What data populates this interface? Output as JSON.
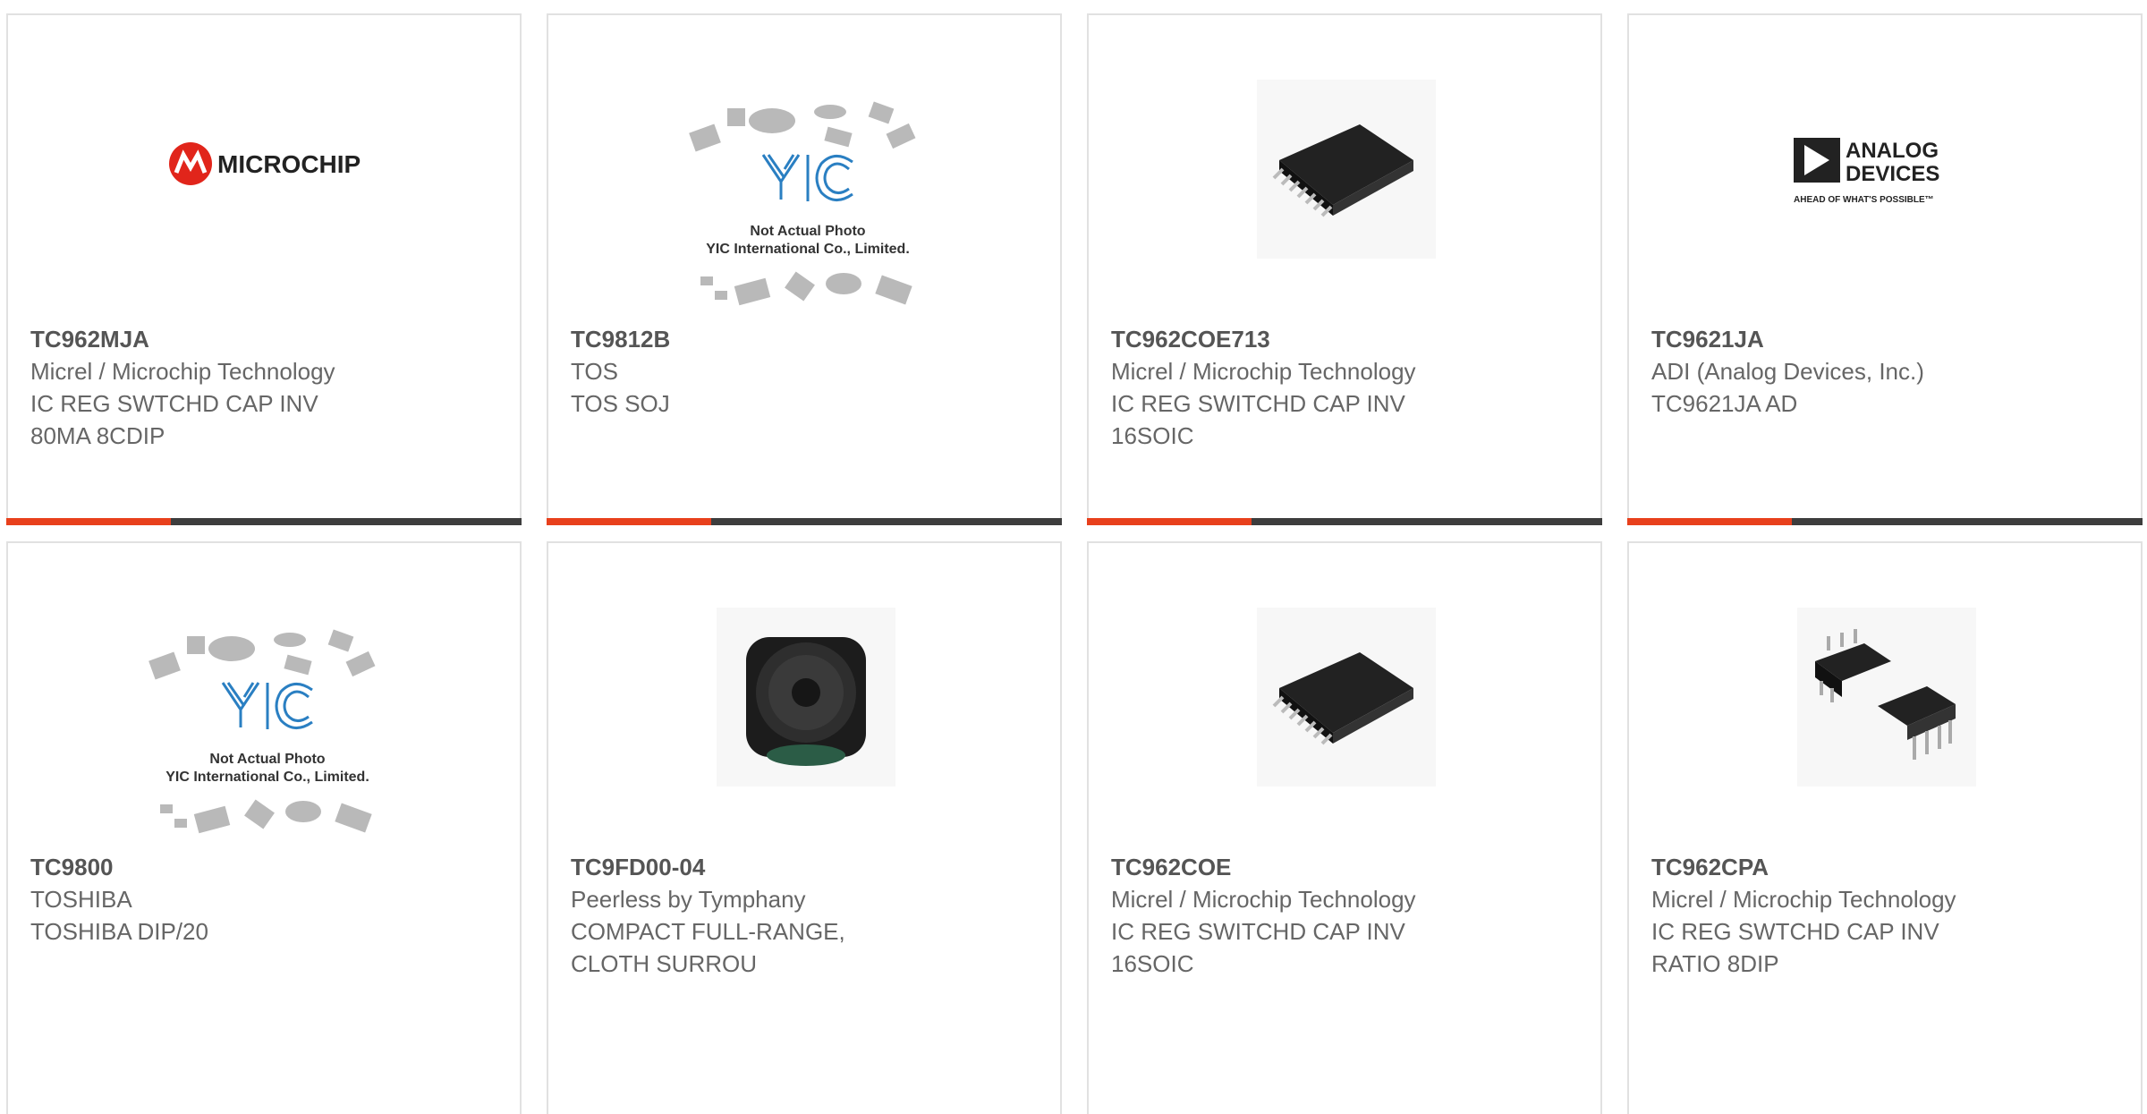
{
  "colors": {
    "accent": "#e8401c",
    "bar": "#3d3d3d",
    "border": "#e1e1e1"
  },
  "products": [
    {
      "part": "TC962MJA",
      "maker": "Micrel / Microchip Technology",
      "desc1": "IC REG SWTCHD CAP INV",
      "desc2": "80MA 8CDIP",
      "image": "microchip-logo",
      "logo_text": "MICROCHIP"
    },
    {
      "part": "TC9812B",
      "maker": "TOS",
      "desc1": "TOS SOJ",
      "desc2": "",
      "image": "yic-placeholder",
      "ph_line1": "Not Actual Photo",
      "ph_line2": "YIC International Co., Limited."
    },
    {
      "part": "TC962COE713",
      "maker": "Micrel / Microchip Technology",
      "desc1": "IC REG SWITCHD CAP INV",
      "desc2": "16SOIC",
      "image": "soic-chip-photo"
    },
    {
      "part": "TC9621JA",
      "maker": "ADI (Analog Devices, Inc.)",
      "desc1": "TC9621JA AD",
      "desc2": "",
      "image": "analog-devices-logo",
      "logo_line1": "ANALOG",
      "logo_line2": "DEVICES",
      "logo_tag": "AHEAD OF WHAT'S POSSIBLE™"
    },
    {
      "part": "TC9800",
      "maker": "TOSHIBA",
      "desc1": "TOSHIBA DIP/20",
      "desc2": "",
      "image": "yic-placeholder",
      "ph_line1": "Not Actual Photo",
      "ph_line2": "YIC International Co., Limited."
    },
    {
      "part": "TC9FD00-04",
      "maker": "Peerless by Tymphany",
      "desc1": "COMPACT FULL-RANGE,",
      "desc2": "CLOTH SURROU",
      "image": "speaker-photo"
    },
    {
      "part": "TC962COE",
      "maker": "Micrel / Microchip Technology",
      "desc1": "IC REG SWITCHD CAP INV",
      "desc2": "16SOIC",
      "image": "soic-chip-photo"
    },
    {
      "part": "TC962CPA",
      "maker": "Micrel / Microchip Technology",
      "desc1": "IC REG SWTCHD CAP INV",
      "desc2": "RATIO 8DIP",
      "image": "dip-chip-photo"
    }
  ]
}
